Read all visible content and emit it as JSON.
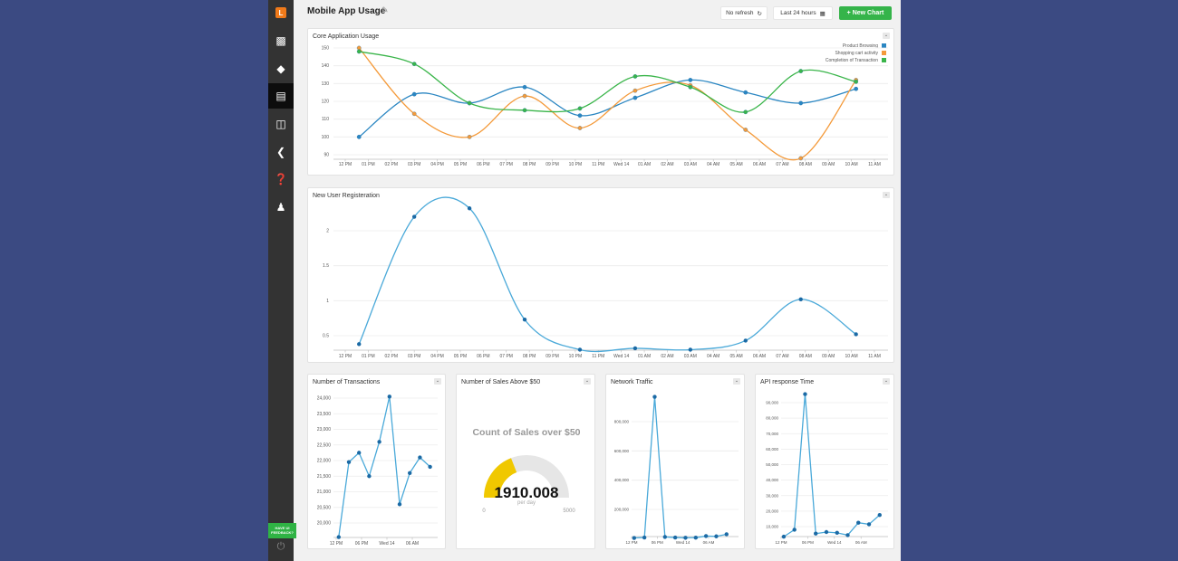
{
  "header": {
    "title": "Mobile App Usage",
    "refresh_label": "No refresh",
    "range_label": "Last 24 hours",
    "new_chart_label": "+ New Chart"
  },
  "sidebar": {
    "logo": "L",
    "items": [
      {
        "icon": "inbox-download-icon"
      },
      {
        "icon": "tag-icon"
      },
      {
        "icon": "bar-chart-icon",
        "active": true
      },
      {
        "icon": "flow-icon"
      },
      {
        "icon": "share-icon"
      },
      {
        "icon": "help-icon"
      },
      {
        "icon": "user-icon"
      }
    ],
    "feedback_label": "HAVE UI FEEDBACK?"
  },
  "colors": {
    "blue": "#2a86c2",
    "orange": "#f49a3a",
    "green": "#3ab54a",
    "line_light": "#4aa9d9",
    "point": "#1b6aa5",
    "gauge": "#f0c800",
    "gauge_bg": "#e6e6e6",
    "new_chart": "#35b44a"
  },
  "chart_data": [
    {
      "id": "core",
      "type": "line",
      "title": "Core Application Usage",
      "smooth": true,
      "x_ticks": [
        "12 PM",
        "01 PM",
        "02 PM",
        "03 PM",
        "04 PM",
        "05 PM",
        "06 PM",
        "07 PM",
        "08 PM",
        "09 PM",
        "10 PM",
        "11 PM",
        "Wed 14",
        "01 AM",
        "02 AM",
        "03 AM",
        "04 AM",
        "05 AM",
        "06 AM",
        "07 AM",
        "08 AM",
        "09 AM",
        "10 AM",
        "11 AM"
      ],
      "y_ticks": [
        90,
        100,
        110,
        120,
        130,
        140,
        150
      ],
      "ylim": [
        88,
        150
      ],
      "grid": true,
      "legend": "top-right",
      "x": [
        "12:36 PM",
        "3:00 PM",
        "5:24 PM",
        "7:48 PM",
        "10:12 PM",
        "12:36 AM",
        "3:00 AM",
        "5:24 AM",
        "7:48 AM",
        "10:12 AM"
      ],
      "series": [
        {
          "name": "Product Browsing",
          "color": "#2a86c2",
          "values": [
            100,
            124,
            119,
            128,
            112,
            122,
            132,
            125,
            119,
            127
          ]
        },
        {
          "name": "Shopping cart activity",
          "color": "#f49a3a",
          "values": [
            150,
            113,
            100,
            123,
            105,
            126,
            129,
            104,
            88,
            132
          ]
        },
        {
          "name": "Completion of Transaction",
          "color": "#3ab54a",
          "values": [
            148,
            141,
            119,
            115,
            116,
            134,
            128,
            114,
            137,
            131
          ]
        }
      ]
    },
    {
      "id": "users",
      "type": "line",
      "title": "New User Registeration",
      "smooth": true,
      "x_ticks": [
        "12 PM",
        "01 PM",
        "02 PM",
        "03 PM",
        "04 PM",
        "05 PM",
        "06 PM",
        "07 PM",
        "08 PM",
        "09 PM",
        "10 PM",
        "11 PM",
        "Wed 14",
        "01 AM",
        "02 AM",
        "03 AM",
        "04 AM",
        "05 AM",
        "06 AM",
        "07 AM",
        "08 AM",
        "09 AM",
        "10 AM",
        "11 AM"
      ],
      "y_ticks": [
        0.5,
        1.0,
        1.5,
        2.0
      ],
      "ylim": [
        0.29,
        2.4
      ],
      "grid": true,
      "x": [
        "12:36 PM",
        "3:00 PM",
        "5:24 PM",
        "7:48 PM",
        "10:12 PM",
        "12:36 AM",
        "3:00 AM",
        "5:24 AM",
        "7:48 AM",
        "10:12 AM"
      ],
      "series": [
        {
          "color": "#4aa9d9",
          "values": [
            0.38,
            2.2,
            2.32,
            0.73,
            0.3,
            0.32,
            0.3,
            0.43,
            1.02,
            0.52
          ]
        }
      ]
    },
    {
      "id": "tx",
      "type": "line",
      "title": "Number of Transactions",
      "smooth": false,
      "x_ticks": [
        "12 PM",
        "06 PM",
        "Wed 14",
        "06 AM"
      ],
      "y_ticks": [
        "20,000",
        "20,500",
        "21,000",
        "21,500",
        "22,000",
        "22,500",
        "23,000",
        "23,500",
        "24,000"
      ],
      "ylim": [
        19550,
        24100
      ],
      "grid": true,
      "x": [
        "12:36 PM",
        "3:00 PM",
        "5:24 PM",
        "7:48 PM",
        "10:12 PM",
        "12:36 AM",
        "3:00 AM",
        "5:24 AM",
        "7:48 AM",
        "10:12 AM"
      ],
      "series": [
        {
          "color": "#4aa9d9",
          "values": [
            19550,
            21950,
            22250,
            21500,
            22600,
            24050,
            20600,
            21600,
            22100,
            21800
          ]
        }
      ]
    },
    {
      "id": "gauge",
      "type": "gauge",
      "title": "Number of Sales Above $50",
      "label": "Count of Sales over $50",
      "value": "1910.008",
      "unit": "per day",
      "min": "0",
      "max": "5000"
    },
    {
      "id": "net",
      "type": "line",
      "title": "Network Traffic",
      "smooth": false,
      "x_ticks": [
        "12 PM",
        "06 PM",
        "Wed 14",
        "06 AM"
      ],
      "y_ticks": [
        "200,000",
        "400,000",
        "600,000",
        "800,000"
      ],
      "ylim": [
        0,
        980000
      ],
      "grid": true,
      "x": [
        "12:36 PM",
        "3:00 PM",
        "5:24 PM",
        "7:48 PM",
        "10:12 PM",
        "12:36 AM",
        "3:00 AM",
        "5:24 AM",
        "7:48 AM",
        "10:12 AM"
      ],
      "series": [
        {
          "color": "#4aa9d9",
          "values": [
            5000,
            8000,
            970000,
            12000,
            8000,
            6000,
            7000,
            18000,
            16000,
            30000
          ]
        }
      ]
    },
    {
      "id": "api",
      "type": "line",
      "title": "API response Time",
      "smooth": false,
      "x_ticks": [
        "12 PM",
        "06 PM",
        "Wed 14",
        "06 AM"
      ],
      "y_ticks": [
        "10,000",
        "20,000",
        "30,000",
        "40,000",
        "50,000",
        "60,000",
        "70,000",
        "80,000",
        "90,000"
      ],
      "ylim": [
        3500,
        96000
      ],
      "grid": true,
      "x": [
        "12:36 PM",
        "3:00 PM",
        "5:24 PM",
        "7:48 PM",
        "10:12 PM",
        "12:36 AM",
        "3:00 AM",
        "5:24 AM",
        "7:48 AM",
        "10:12 AM"
      ],
      "series": [
        {
          "color": "#4aa9d9",
          "values": [
            3500,
            8000,
            95500,
            5500,
            6500,
            6000,
            4500,
            12500,
            11500,
            17500
          ]
        }
      ]
    }
  ]
}
